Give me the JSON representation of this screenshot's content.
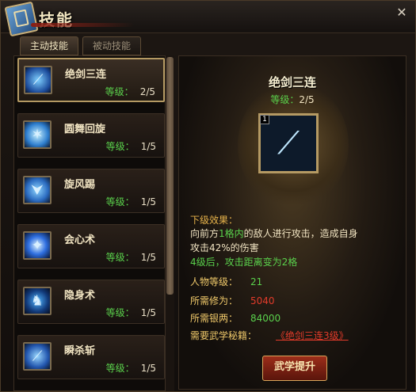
{
  "window": {
    "title": "技能"
  },
  "tabs": [
    {
      "label": "主动技能"
    },
    {
      "label": "被动技能"
    }
  ],
  "skills": [
    {
      "name": "绝剑三连",
      "level_label": "等级：",
      "level": "2/5",
      "icon": "sword-icon",
      "color": "#2d8fff"
    },
    {
      "name": "圆舞回旋",
      "level_label": "等级：",
      "level": "1/5",
      "icon": "spin-blades-icon",
      "color": "#39b7ff"
    },
    {
      "name": "旋风踢",
      "level_label": "等级：",
      "level": "1/5",
      "icon": "boot-icon",
      "color": "#3b9cff"
    },
    {
      "name": "会心术",
      "level_label": "等级：",
      "level": "1/5",
      "icon": "spark-icon",
      "color": "#1f78ff"
    },
    {
      "name": "隐身术",
      "level_label": "等级：",
      "level": "1/5",
      "icon": "shadow-figure-icon",
      "color": "#2a8cff"
    },
    {
      "name": "瞬杀斩",
      "level_label": "等级：",
      "level": "1/5",
      "icon": "slash-icon",
      "color": "#35a8ff"
    }
  ],
  "detail": {
    "name": "绝剑三连",
    "level_label": "等级：",
    "level": "2/5",
    "slot_number": "1",
    "next_level_label": "下级效果：",
    "desc_part1": "向前方",
    "desc_highlight": "1格内",
    "desc_part2": "的敌人进行攻击，造成自身",
    "desc_line2": "攻击42%的伤害",
    "desc_line3": "4级后，攻击距离变为2格",
    "char_level_label": "人物等级：",
    "char_level": "21",
    "cultivation_label": "所需修为：",
    "cultivation": "5040",
    "silver_label": "所需银两：",
    "silver": "84000",
    "manual_label": "需要武学秘籍：",
    "manual": "《绝剑三连3级》",
    "learn_button": "武学提升"
  }
}
